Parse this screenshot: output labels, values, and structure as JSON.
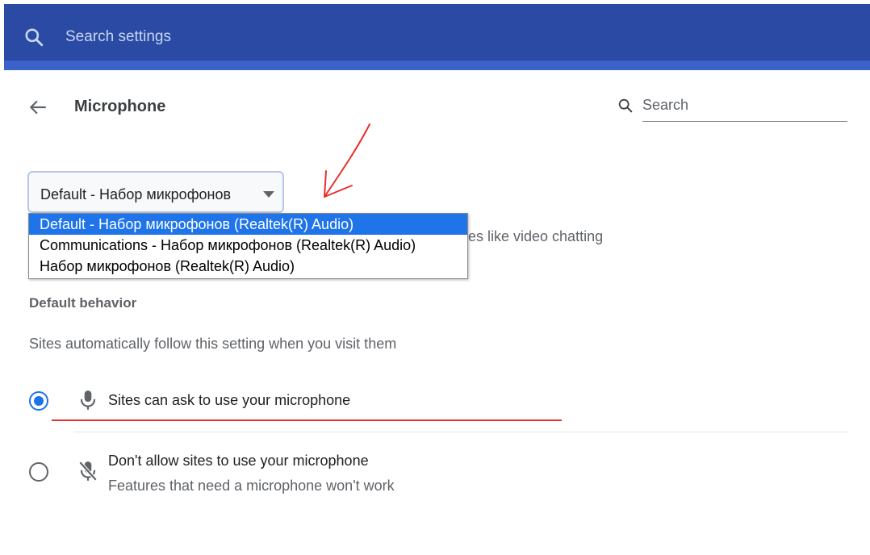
{
  "topbar": {
    "search_placeholder": "Search settings",
    "search_icon": "search-icon",
    "background_color": "#2a4aa4"
  },
  "header": {
    "back_icon": "arrow-left-icon",
    "title": "Microphone",
    "search_label": "Search",
    "search_icon": "search-icon"
  },
  "mic_select": {
    "value": "Default - Набор микрофонов",
    "options": [
      "Default - Набор микрофонов (Realtek(R) Audio)",
      "Communications - Набор микрофонов (Realtek(R) Audio)",
      "Набор микрофонов (Realtek(R) Audio)"
    ],
    "selected_index": 0,
    "highlight_color": "#1e74e8"
  },
  "partially_hidden_text": "res like video chatting",
  "default_behavior": {
    "heading": "Default behavior",
    "description": "Sites automatically follow this setting when you visit them",
    "options": [
      {
        "label": "Sites can ask to use your microphone",
        "sublabel": "",
        "icon": "microphone-icon",
        "selected": true
      },
      {
        "label": "Don't allow sites to use your microphone",
        "sublabel": "Features that need a microphone won't work",
        "icon": "microphone-off-icon",
        "selected": false
      }
    ],
    "accent_color": "#1a73e8"
  },
  "annotations": {
    "arrow_color": "#e8302c",
    "underline_color": "#e8302c"
  }
}
